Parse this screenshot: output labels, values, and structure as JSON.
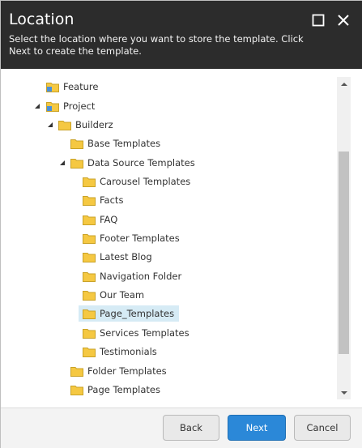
{
  "dialog": {
    "title": "Location",
    "subtitle": "Select the location where you want to store the template. Click Next to create the template."
  },
  "header_icons": {
    "maximize": "maximize-icon",
    "close": "close-icon"
  },
  "tree": {
    "items": [
      {
        "label": "Feature",
        "icon": "folder-link-icon",
        "expanded": null
      },
      {
        "label": "Project",
        "icon": "folder-link-icon",
        "expanded": true
      },
      {
        "label": "Builderz",
        "icon": "folder-icon",
        "expanded": true
      },
      {
        "label": "Base Templates",
        "icon": "folder-icon",
        "expanded": null
      },
      {
        "label": "Data Source Templates",
        "icon": "folder-icon",
        "expanded": true
      },
      {
        "label": "Carousel Templates",
        "icon": "folder-icon",
        "expanded": null
      },
      {
        "label": "Facts",
        "icon": "folder-icon",
        "expanded": null
      },
      {
        "label": "FAQ",
        "icon": "folder-icon",
        "expanded": null
      },
      {
        "label": "Footer Templates",
        "icon": "folder-icon",
        "expanded": null
      },
      {
        "label": "Latest Blog",
        "icon": "folder-icon",
        "expanded": null
      },
      {
        "label": "Navigation Folder",
        "icon": "folder-icon",
        "expanded": null
      },
      {
        "label": "Our Team",
        "icon": "folder-icon",
        "expanded": null
      },
      {
        "label": "Page_Templates",
        "icon": "folder-icon",
        "expanded": null,
        "selected": true
      },
      {
        "label": "Services Templates",
        "icon": "folder-icon",
        "expanded": null
      },
      {
        "label": "Testimonials",
        "icon": "folder-icon",
        "expanded": null
      },
      {
        "label": "Folder Templates",
        "icon": "folder-icon",
        "expanded": null
      },
      {
        "label": "Page Templates",
        "icon": "folder-icon",
        "expanded": null
      }
    ]
  },
  "footer": {
    "back_label": "Back",
    "next_label": "Next",
    "cancel_label": "Cancel"
  },
  "colors": {
    "header_bg": "#2c2c2c",
    "primary_button": "#2b88d8",
    "selected_row": "#d6ebf5",
    "folder_yellow": "#f5c842"
  }
}
